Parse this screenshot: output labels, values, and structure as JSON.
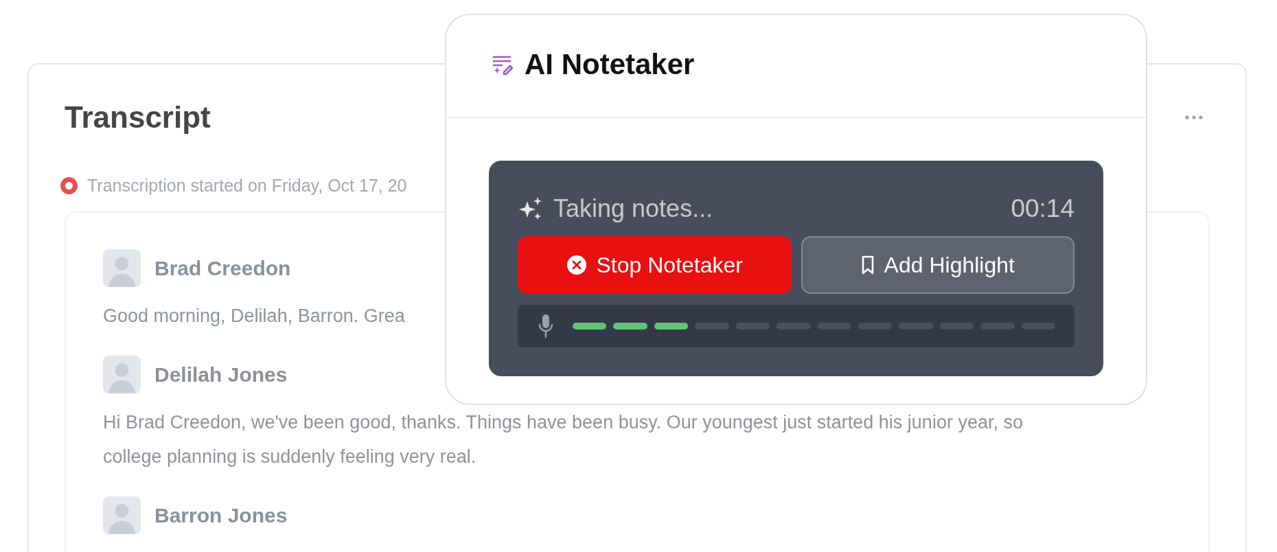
{
  "transcript": {
    "title": "Transcript",
    "status": {
      "text": "Transcription started on Friday, Oct 17, 20",
      "recording": true
    },
    "entries": [
      {
        "speaker": "Brad Creedon",
        "message": "Good morning, Delilah, Barron. Grea"
      },
      {
        "speaker": "Delilah Jones",
        "message": "Hi Brad Creedon, we've been good, thanks. Things have been busy. Our youngest just started his junior year, so college planning is suddenly feeling very real."
      },
      {
        "speaker": "Barron Jones"
      }
    ]
  },
  "notetaker": {
    "title": "AI Notetaker",
    "status": "Taking notes...",
    "timer": "00:14",
    "buttons": [
      {
        "kind": "stop",
        "label": "Stop Notetaker"
      },
      {
        "kind": "highlight",
        "label": "Add Highlight"
      }
    ],
    "meter": {
      "level": 0.25
    }
  }
}
